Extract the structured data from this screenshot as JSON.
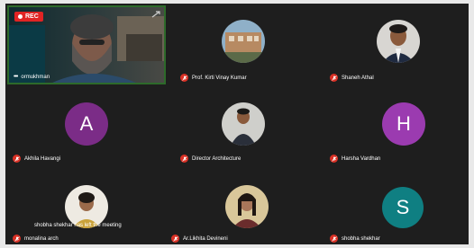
{
  "recording": {
    "label": "REC"
  },
  "participants": [
    {
      "name": "ormukhman",
      "muted": false,
      "video": true
    },
    {
      "name": "Prof. Kirti Vinay Kumar",
      "muted": true
    },
    {
      "name": "Shaneh Athal",
      "muted": true
    },
    {
      "name": "Akhila Havangi",
      "muted": true,
      "initial": "A",
      "color": "#7b2c87"
    },
    {
      "name": "Director Architecture",
      "muted": true
    },
    {
      "name": "Harsha Vardhan",
      "muted": true,
      "initial": "H",
      "color": "#9b3bb0"
    },
    {
      "name": "monalina arch",
      "muted": true
    },
    {
      "name": "Ar.Likhita Devineni",
      "muted": true
    },
    {
      "name": "shobha shekhar",
      "muted": true,
      "initial": "S",
      "color": "#0f7f82"
    }
  ],
  "notification": {
    "text": "shobha shekhar has left the meeting"
  },
  "icons": {
    "mute": "mic-off-icon",
    "more": "more-options-icon",
    "expand": "expand-icon"
  },
  "colors": {
    "background": "#1e1e1e",
    "active_border": "#2d6a2a",
    "mute": "#d93025",
    "rec": "#e02424"
  }
}
